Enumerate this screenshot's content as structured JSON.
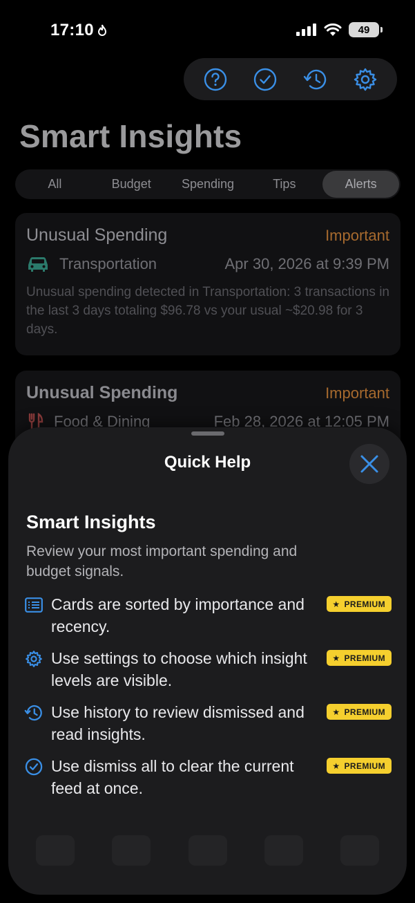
{
  "status_bar": {
    "time": "17:10",
    "battery": "49"
  },
  "toolbar": {
    "icons": [
      "help-icon",
      "checkmark-circle-icon",
      "history-icon",
      "gear-icon"
    ]
  },
  "page": {
    "title": "Smart Insights"
  },
  "tabs": [
    {
      "label": "All"
    },
    {
      "label": "Budget"
    },
    {
      "label": "Spending"
    },
    {
      "label": "Tips"
    },
    {
      "label": "Alerts",
      "selected": true
    }
  ],
  "cards": [
    {
      "title": "Unusual Spending",
      "badge": "Important",
      "category": "Transportation",
      "date": "Apr 30, 2026 at 9:39 PM",
      "body": "Unusual spending detected in Transportation: 3 transactions in the last 3 days totaling $96.78 vs your usual ~$20.98 for 3 days."
    },
    {
      "title": "Unusual Spending",
      "badge": "Important",
      "category": "Food & Dining",
      "date": "Feb 28, 2026 at 12:05 PM"
    }
  ],
  "sheet": {
    "title": "Quick Help",
    "heading": "Smart Insights",
    "description": "Review your most important spending and budget signals.",
    "premium_label": "PREMIUM",
    "tips": [
      {
        "icon": "list-icon",
        "text": "Cards are sorted by importance and recency."
      },
      {
        "icon": "gear-icon",
        "text": "Use settings to choose which insight levels are visible."
      },
      {
        "icon": "history-icon",
        "text": "Use history to review dismissed and read insights."
      },
      {
        "icon": "checkmark-circle-icon",
        "text": "Use dismiss all to clear the current feed at once."
      }
    ]
  },
  "colors": {
    "accent": "#3a8fe6",
    "important": "#a76a2e",
    "premium": "#f5cf2e"
  }
}
